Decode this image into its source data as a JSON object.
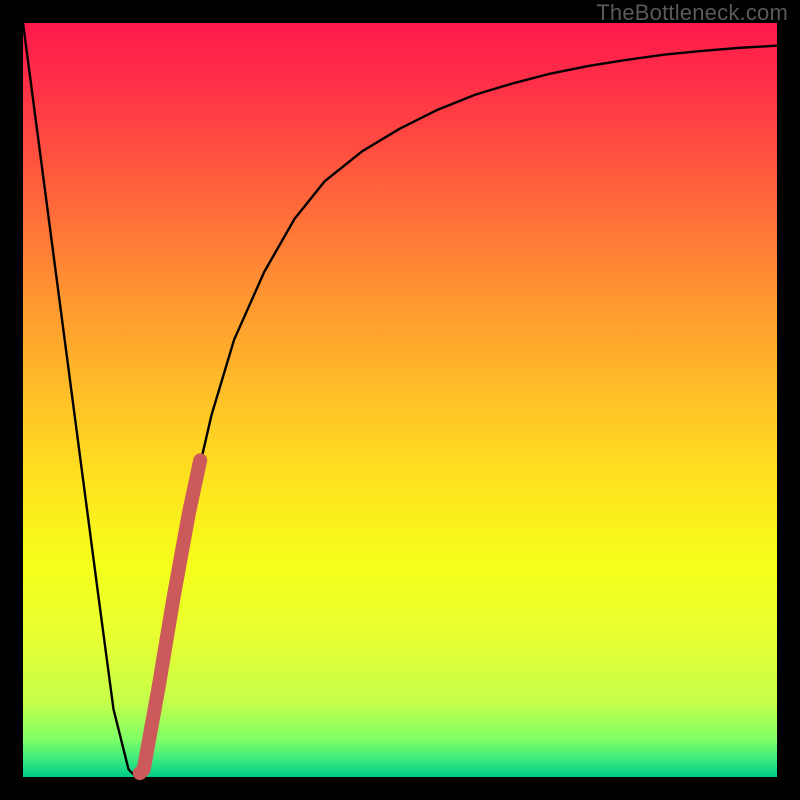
{
  "watermark": "TheBottleneck.com",
  "colors": {
    "background": "#000000",
    "curve_stroke": "#000000",
    "highlight_stroke": "#cc5a5a",
    "gradient_top": "#ff1a4c",
    "gradient_bottom": "#00cc88"
  },
  "chart_data": {
    "type": "line",
    "title": "",
    "xlabel": "",
    "ylabel": "",
    "xlim": [
      0,
      100
    ],
    "ylim": [
      0,
      100
    ],
    "series": [
      {
        "name": "bottleneck-curve",
        "x": [
          0,
          5,
          10,
          12,
          14,
          15,
          16,
          18,
          20,
          22,
          25,
          28,
          32,
          36,
          40,
          45,
          50,
          55,
          60,
          65,
          70,
          75,
          80,
          85,
          90,
          95,
          100
        ],
        "values": [
          100,
          62,
          24,
          9,
          1,
          0,
          1,
          12,
          24,
          35,
          48,
          58,
          67,
          74,
          79,
          83,
          86,
          88.5,
          90.5,
          92,
          93.3,
          94.3,
          95.1,
          95.8,
          96.3,
          96.7,
          97
        ]
      },
      {
        "name": "highlight-segment",
        "x": [
          15.5,
          16,
          18,
          20,
          22,
          23.5
        ],
        "values": [
          0.5,
          1,
          12,
          24,
          35,
          42
        ]
      }
    ],
    "annotations": []
  }
}
